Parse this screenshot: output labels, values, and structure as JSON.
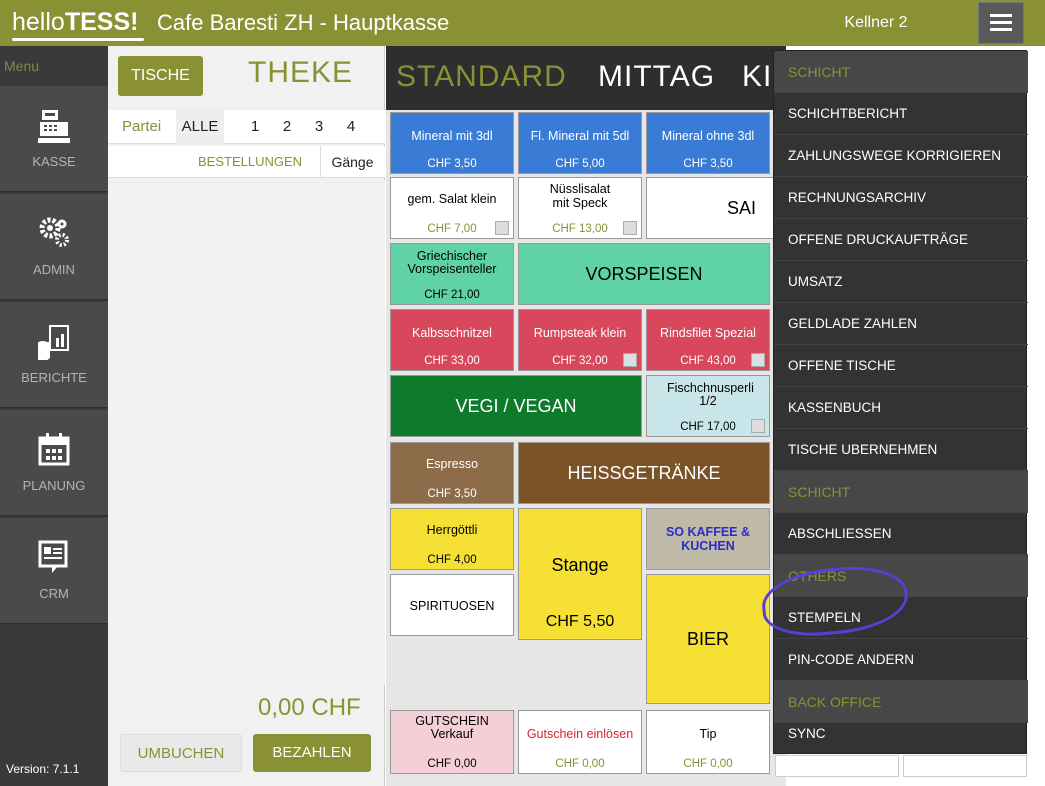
{
  "header": {
    "logo_prefix": "hello",
    "logo_bold": "TESS!",
    "title": "Cafe Baresti ZH - Hauptkasse",
    "user": "Kellner 2"
  },
  "nav": {
    "menu_label": "Menu",
    "items": [
      {
        "label": "KASSE",
        "icon": "register-icon"
      },
      {
        "label": "ADMIN",
        "icon": "gears-icon"
      },
      {
        "label": "BERICHTE",
        "icon": "report-icon"
      },
      {
        "label": "PLANUNG",
        "icon": "calendar-icon"
      },
      {
        "label": "CRM",
        "icon": "crm-icon"
      }
    ],
    "version": "Version: 7.1.1"
  },
  "order": {
    "tables_button": "TISCHE",
    "location": "THEKE",
    "party_label": "Partei",
    "parties": [
      "ALLE",
      "1",
      "2",
      "3",
      "4"
    ],
    "orders_tab": "BESTELLUNGEN",
    "courses_tab": "Gänge",
    "total": "0,00 CHF",
    "rebook_button": "UMBUCHEN",
    "pay_button": "BEZAHLEN"
  },
  "categories": [
    "STANDARD",
    "MITTAG",
    "KI"
  ],
  "products": {
    "mineral_3dl": {
      "name": "Mineral mit 3dl",
      "price": "CHF 3,50"
    },
    "mineral_5dl": {
      "name": "Fl. Mineral mit 5dl",
      "price": "CHF 5,00"
    },
    "mineral_ohne": {
      "name": "Mineral ohne 3dl",
      "price": "CHF 3,50"
    },
    "salat_klein": {
      "name": "gem. Salat klein",
      "price": "CHF 7,00"
    },
    "nuesslisalat": {
      "name": "Nüsslisalat mit Speck",
      "price": "CHF 13,00"
    },
    "sal_cut": {
      "name": "SAI"
    },
    "vorspeisenteller": {
      "name": "Griechischer Vorspeisenteller",
      "price": "CHF 21,00"
    },
    "vorspeisen": {
      "name": "VORSPEISEN"
    },
    "kalbsschnitzel": {
      "name": "Kalbsschnitzel",
      "price": "CHF 33,00"
    },
    "rumpsteak": {
      "name": "Rumpsteak klein",
      "price": "CHF 32,00"
    },
    "rindsfilet": {
      "name": "Rindsfilet Spezial",
      "price": "CHF 43,00"
    },
    "vegi": {
      "name": "VEGI / VEGAN"
    },
    "fischchnusperli": {
      "name": "Fischchnusperli 1/2",
      "price": "CHF 17,00"
    },
    "espresso": {
      "name": "Espresso",
      "price": "CHF 3,50"
    },
    "heissgetraenke": {
      "name": "HEISSGETRÄNKE"
    },
    "herrgoettli": {
      "name": "Herrgöttli",
      "price": "CHF 4,00"
    },
    "stange": {
      "name": "Stange",
      "price": "CHF 5,50"
    },
    "kaffee_kuchen": {
      "name": "SO KAFFEE & KUCHEN"
    },
    "spirituosen": {
      "name": "SPIRITUOSEN"
    },
    "bier": {
      "name": "BIER"
    },
    "gutschein_verkauf": {
      "name": "GUTSCHEIN Verkauf",
      "price": "CHF 0,00"
    },
    "gutschein_einloesen": {
      "name": "Gutschein einlösen",
      "price": "CHF 0,00"
    },
    "tip": {
      "name": "Tip",
      "price": "CHF 0,00"
    }
  },
  "menu": {
    "items": [
      {
        "label": "SCHICHT",
        "section": true
      },
      {
        "label": "SCHICHTBERICHT"
      },
      {
        "label": "ZAHLUNGSWEGE KORRIGIEREN"
      },
      {
        "label": "RECHNUNGSARCHIV"
      },
      {
        "label": "OFFENE DRUCKAUFTRÄGE"
      },
      {
        "label": "UMSATZ"
      },
      {
        "label": "GELDLADE ZAHLEN"
      },
      {
        "label": "OFFENE TISCHE"
      },
      {
        "label": "KASSENBUCH"
      },
      {
        "label": "TISCHE UBERNEHMEN"
      },
      {
        "label": "SCHICHT",
        "section": true
      },
      {
        "label": "ABSCHLIESSEN"
      },
      {
        "label": "OTHERS",
        "section": true
      },
      {
        "label": "STEMPELN"
      },
      {
        "label": "PIN-CODE ANDERN"
      },
      {
        "label": "BACK OFFICE",
        "section": true
      },
      {
        "label": "SYNC"
      }
    ]
  },
  "colors": {
    "accent": "#8a9134",
    "annotation": "#5a3fd6"
  }
}
